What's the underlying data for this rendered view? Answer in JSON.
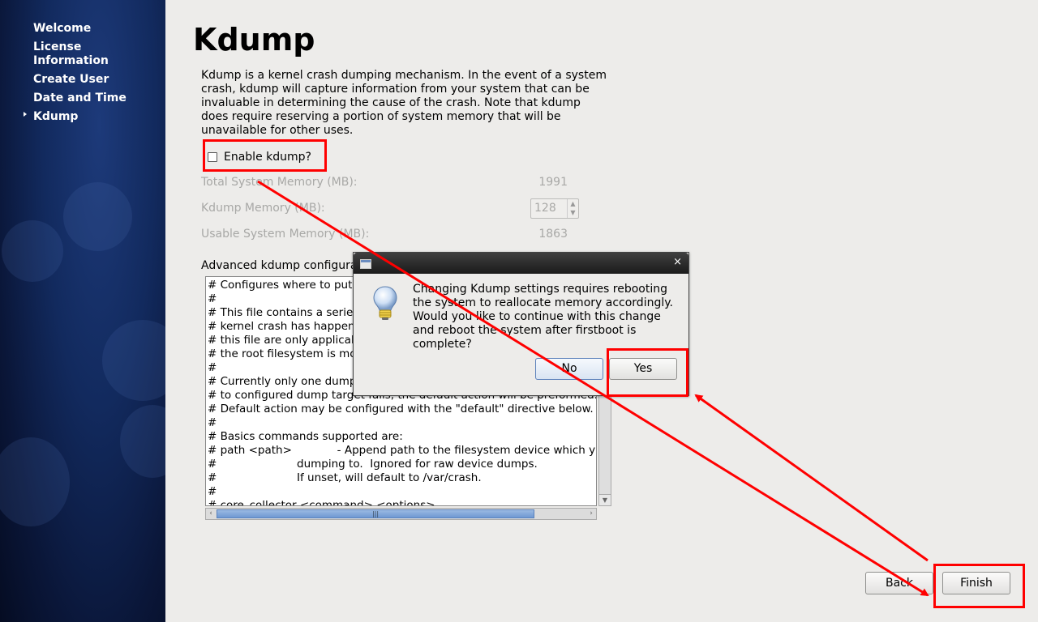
{
  "sidebar": {
    "items": [
      {
        "label": "Welcome"
      },
      {
        "label": "License Information"
      },
      {
        "label": "Create User"
      },
      {
        "label": "Date and Time"
      },
      {
        "label": "Kdump",
        "active": true
      }
    ]
  },
  "main": {
    "title": "Kdump",
    "description": "Kdump is a kernel crash dumping mechanism. In the event of a system crash, kdump will capture information from your system that can be invaluable in determining the cause of the crash. Note that kdump does require reserving a portion of system memory that will be unavailable for other uses.",
    "enable_label": "Enable kdump?",
    "total_memory_label": "Total System Memory (MB):",
    "total_memory_value": "1991",
    "kdump_memory_label": "Kdump Memory (MB):",
    "kdump_memory_value": "128",
    "usable_memory_label": "Usable System Memory (MB):",
    "usable_memory_value": "1863",
    "advanced_label": "Advanced kdump configurat",
    "config_text": "# Configures where to put the kdump /proc/vmcore files\n#\n# This file contains a series of commands to perform (in order) when a\n# kernel crash has happened and the kdump kernel has been loaded.  Directives in\n# this file are only applicable to the kdump initramfs, and have no effect if\n# the root filesystem is mounted and the normal init scripts are processed\n#\n# Currently only one dump target and path may be configured at once\n# to configured dump target fails, the default action will be preformed.\n# Default action may be configured with the \"default\" directive below.\n#\n# Basics commands supported are:\n# path <path>             - Append path to the filesystem device which y\n#                       dumping to.  Ignored for raw device dumps.\n#                       If unset, will default to /var/crash.\n#\n# core_collector <command> <options>"
  },
  "footer": {
    "back_label": "Back",
    "finish_label": "Finish"
  },
  "dialog": {
    "close_glyph": "×",
    "message": "Changing Kdump settings requires rebooting the system to reallocate memory accordingly. Would you like to continue with this change and reboot the system after firstboot is complete?",
    "no_label": "No",
    "yes_label": "Yes"
  },
  "colors": {
    "annotation": "#ff0000",
    "sidebar": "#122a5e"
  }
}
